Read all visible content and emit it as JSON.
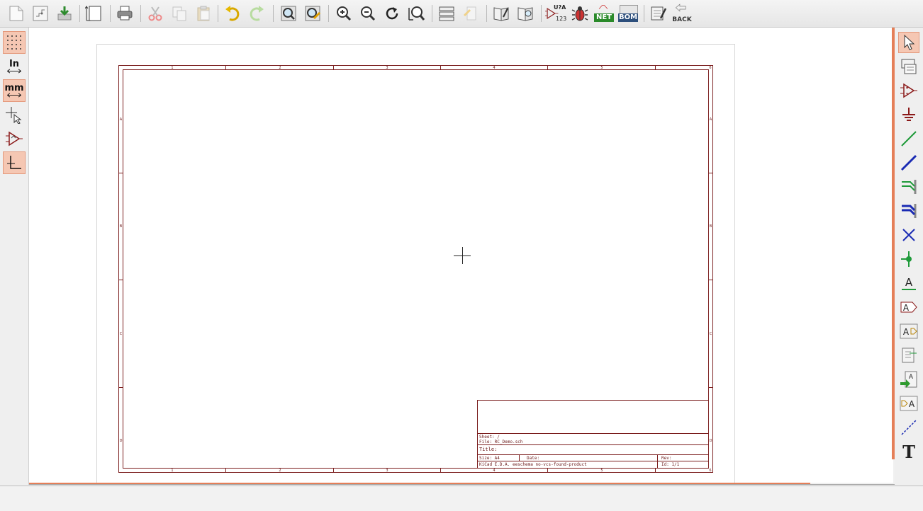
{
  "top_toolbar": {
    "icons": [
      "new-schematic-icon",
      "open-schematic-icon",
      "save-icon",
      "page-settings-icon",
      "print-icon",
      "cut-icon",
      "copy-icon",
      "paste-icon",
      "undo-icon",
      "redo-icon",
      "find-icon",
      "find-replace-icon",
      "zoom-in-icon",
      "zoom-out-icon",
      "redraw-icon",
      "zoom-fit-icon",
      "hierarchy-navigator-icon",
      "leave-sheet-icon",
      "library-editor-icon",
      "library-browser-icon",
      "annotate-icon",
      "erc-icon",
      "netlist-icon",
      "bom-icon",
      "edit-fields-icon",
      "back-to-pcb-icon"
    ],
    "annotate_text": "U?A",
    "annotate_sub": "123",
    "netlist_text": "NET",
    "bom_text": "BOM",
    "back_text": "BACK"
  },
  "left_toolbar": {
    "units_in_label": "In",
    "units_mm_label": "mm"
  },
  "canvas": {
    "border_ticks_horizontal": [
      "1",
      "2",
      "3",
      "4",
      "5",
      "6"
    ],
    "border_ticks_vertical": [
      "A",
      "B",
      "C",
      "D"
    ],
    "title_block": {
      "sheet": "Sheet: /",
      "file": "File: RC_Demo.sch",
      "title": "Title:",
      "size": "Size: A4",
      "date": "Date:",
      "rev": "Rev:",
      "kicad": "KiCad E.D.A.  eeschema no-vcs-found-product",
      "id": "Id: 1/1"
    }
  },
  "colors": {
    "accent": "#e57f58",
    "sheet_border": "#7b1e1e",
    "toolbar_active": "#f5c7b3",
    "wire_green": "#1f9a3a",
    "bus_blue": "#1a2bb3"
  }
}
